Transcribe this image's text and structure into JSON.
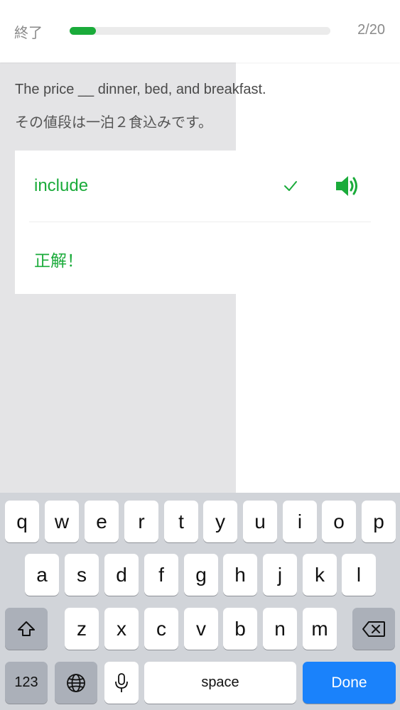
{
  "header": {
    "quit_label": "終了",
    "progress_current": 2,
    "progress_total": 20,
    "progress_fraction": 0.1,
    "progress_text": "2/20"
  },
  "question": {
    "sentence_en": "The price __ dinner, bed, and breakfast.",
    "sentence_ja": "その値段は一泊２食込みです。"
  },
  "answer": {
    "word": "include",
    "feedback": "正解！",
    "check_icon": "checkmark-icon",
    "speaker_icon": "speaker-icon"
  },
  "keyboard": {
    "row1": [
      "q",
      "w",
      "e",
      "r",
      "t",
      "y",
      "u",
      "i",
      "o",
      "p"
    ],
    "row2": [
      "a",
      "s",
      "d",
      "f",
      "g",
      "h",
      "j",
      "k",
      "l"
    ],
    "row3": [
      "z",
      "x",
      "c",
      "v",
      "b",
      "n",
      "m"
    ],
    "numbers_label": "123",
    "space_label": "space",
    "done_label": "Done",
    "shift_icon": "shift-icon",
    "backspace_icon": "backspace-icon",
    "globe_icon": "globe-icon",
    "mic_icon": "microphone-icon"
  },
  "colors": {
    "accent_green": "#1aab3a",
    "done_blue": "#1a82fb",
    "progress_track": "#ebebeb"
  }
}
